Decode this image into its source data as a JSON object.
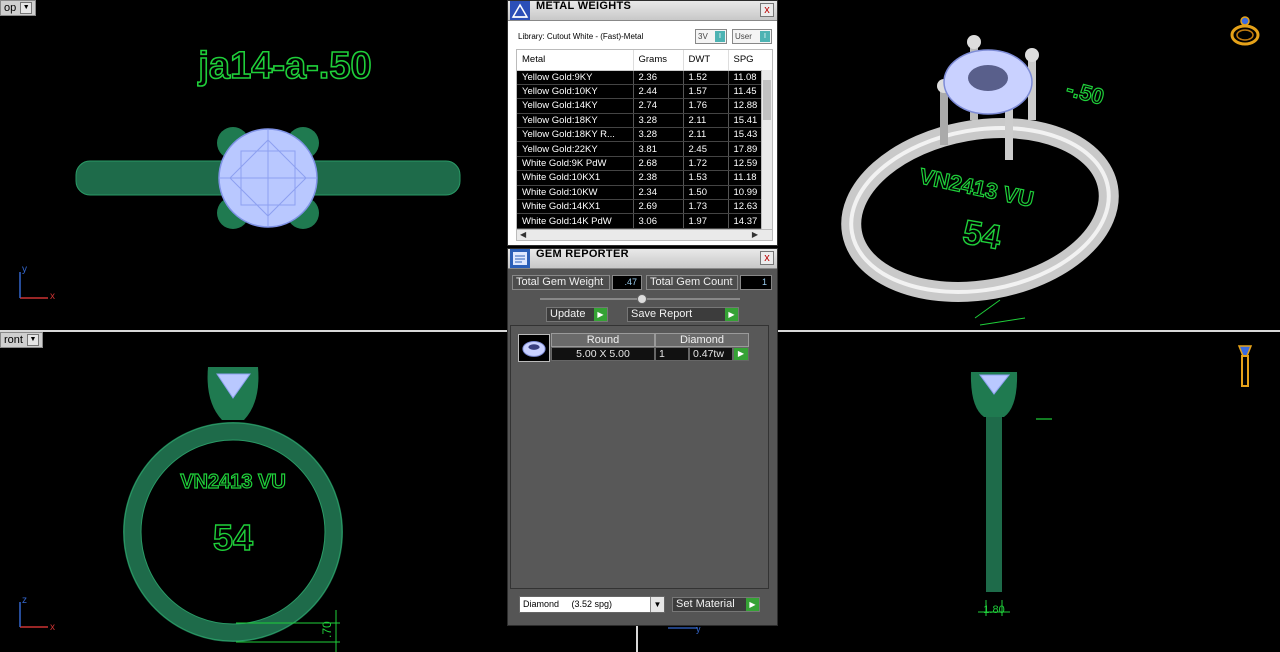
{
  "viewports": {
    "top": {
      "label": "op",
      "model_name": "ja14-a-.50",
      "axis_x": "x",
      "axis_y": "y"
    },
    "perspective": {
      "engraving_line1": "VN2413 VU",
      "engraving_size": "54",
      "partial_text": "-.50"
    },
    "front": {
      "label": "ront",
      "engraving_line1": "VN2413 VU",
      "engraving_size": "54",
      "axis_x": "x",
      "axis_z": "z",
      "dimension": ".70"
    },
    "right": {
      "dimension": "1.80",
      "axis_label": "y"
    }
  },
  "metal_weights": {
    "title": "METAL WEIGHTS",
    "close": "x",
    "library": "Library: Cutout White - (Fast)-Metal",
    "toggle_1": "3V",
    "toggle_2": "User",
    "columns": [
      "Metal",
      "Grams",
      "DWT",
      "SPG"
    ],
    "rows": [
      [
        "Yellow Gold:9KY",
        "2.36",
        "1.52",
        "11.08"
      ],
      [
        "Yellow Gold:10KY",
        "2.44",
        "1.57",
        "11.45"
      ],
      [
        "Yellow Gold:14KY",
        "2.74",
        "1.76",
        "12.88"
      ],
      [
        "Yellow Gold:18KY",
        "3.28",
        "2.11",
        "15.41"
      ],
      [
        "Yellow Gold:18KY R...",
        "3.28",
        "2.11",
        "15.43"
      ],
      [
        "Yellow Gold:22KY",
        "3.81",
        "2.45",
        "17.89"
      ],
      [
        "White Gold:9K PdW",
        "2.68",
        "1.72",
        "12.59"
      ],
      [
        "White Gold:10KX1",
        "2.38",
        "1.53",
        "11.18"
      ],
      [
        "White Gold:10KW",
        "2.34",
        "1.50",
        "10.99"
      ],
      [
        "White Gold:14KX1",
        "2.69",
        "1.73",
        "12.63"
      ],
      [
        "White Gold:14K PdW",
        "3.06",
        "1.97",
        "14.37"
      ]
    ]
  },
  "gem_reporter": {
    "title": "GEM REPORTER",
    "close": "x",
    "total_weight_label": "Total Gem Weight",
    "total_weight_value": ".47",
    "total_count_label": "Total Gem Count",
    "total_count_value": "1",
    "update_label": "Update",
    "save_label": "Save Report",
    "gem": {
      "shape": "Round",
      "material": "Diamond",
      "size": "5.00 X 5.00",
      "count": "1",
      "weight": "0.47tw"
    },
    "material_select": "Diamond     (3.52 spg)",
    "set_material_label": "Set Material"
  },
  "colors": {
    "wireframe_green": "#1fcf3a",
    "ring_green": "#1e6b4a",
    "gem_blue": "#b9c8ff",
    "accent_go": "#35a235",
    "gold_icon": "#e6a219"
  }
}
